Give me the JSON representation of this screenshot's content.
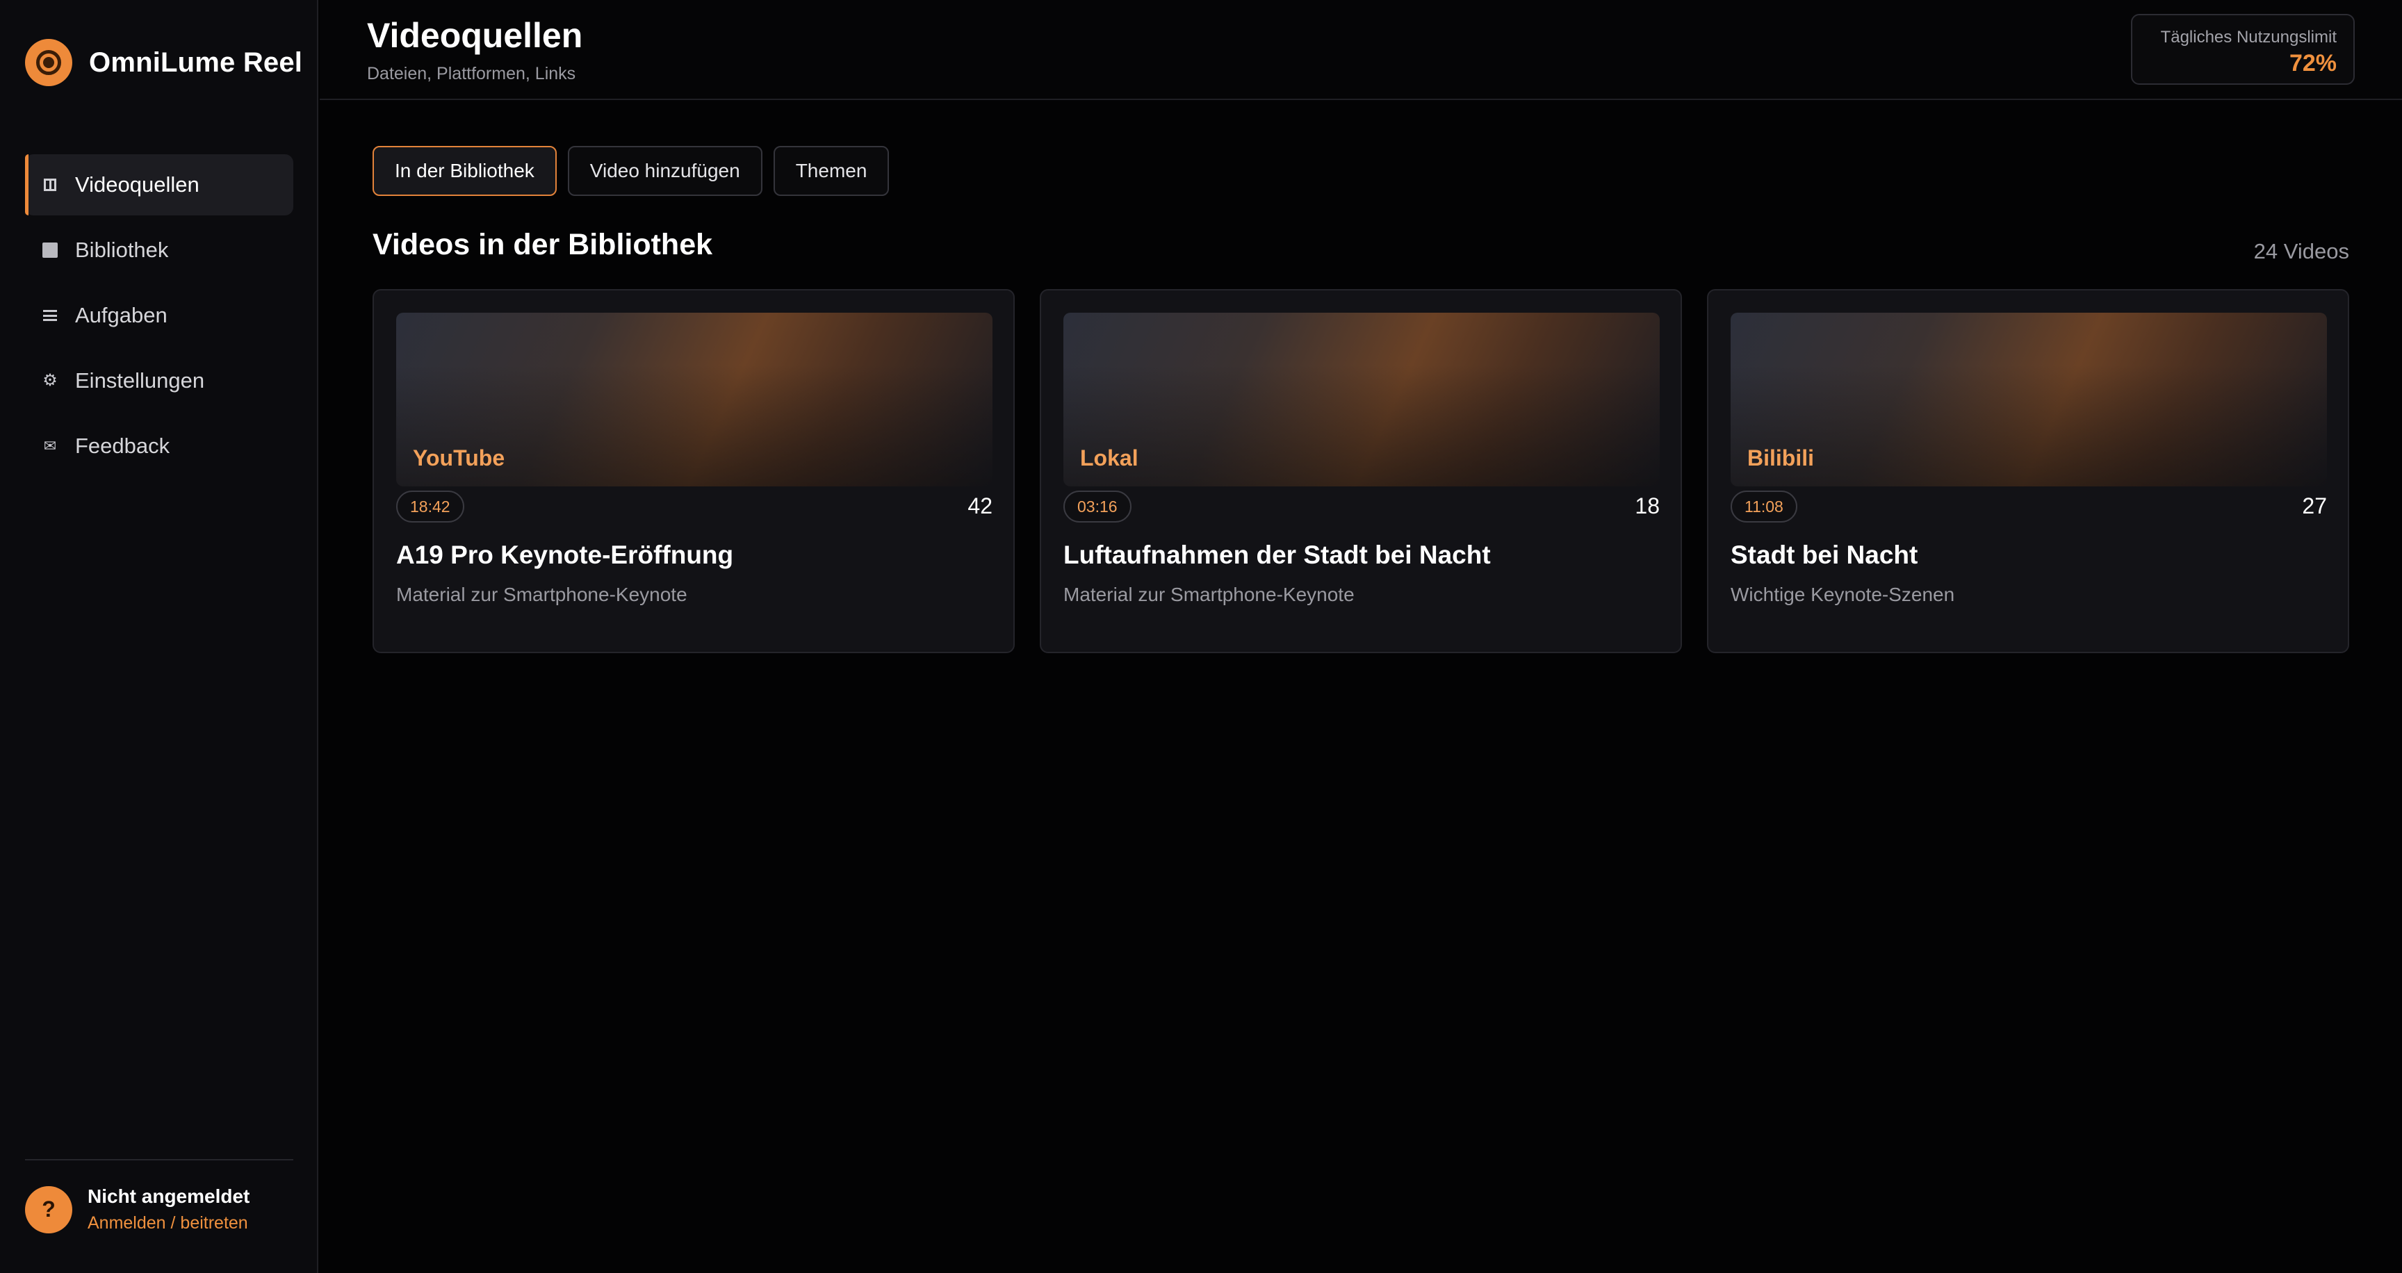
{
  "app": {
    "name": "OmniLume Reel",
    "accent_color": "#ee8a3a",
    "logo_icon": "film-reel-icon"
  },
  "sidebar": {
    "items": [
      {
        "label": "Videoquellen",
        "icon": "columns-icon",
        "active": true
      },
      {
        "label": "Bibliothek",
        "icon": "library-square-icon",
        "active": false
      },
      {
        "label": "Aufgaben",
        "icon": "list-icon",
        "active": false
      },
      {
        "label": "Einstellungen",
        "icon": "gear-icon",
        "active": false
      },
      {
        "label": "Feedback",
        "icon": "mail-icon",
        "active": false
      }
    ],
    "user": {
      "avatar_glyph": "?",
      "status": "Nicht angemeldet",
      "action": "Anmelden / beitreten"
    }
  },
  "header": {
    "title": "Videoquellen",
    "subtitle": "Dateien, Plattformen, Links",
    "usage": {
      "label": "Tägliches Nutzungslimit",
      "value": "72%"
    }
  },
  "main": {
    "tabs": [
      {
        "label": "In der Bibliothek",
        "active": true
      },
      {
        "label": "Video hinzufügen",
        "active": false
      },
      {
        "label": "Themen",
        "active": false
      }
    ],
    "section_title": "Videos in der Bibliothek",
    "video_count": "24 Videos",
    "videos": [
      {
        "source": "YouTube",
        "duration": "18:42",
        "count": "42",
        "title": "A19 Pro Keynote-Eröffnung",
        "description": "Material zur Smartphone-Keynote"
      },
      {
        "source": "Lokal",
        "duration": "03:16",
        "count": "18",
        "title": "Luftaufnahmen der Stadt bei Nacht",
        "description": "Material zur Smartphone-Keynote"
      },
      {
        "source": "Bilibili",
        "duration": "11:08",
        "count": "27",
        "title": "Stadt bei Nacht",
        "description": "Wichtige Keynote-Szenen"
      }
    ]
  }
}
